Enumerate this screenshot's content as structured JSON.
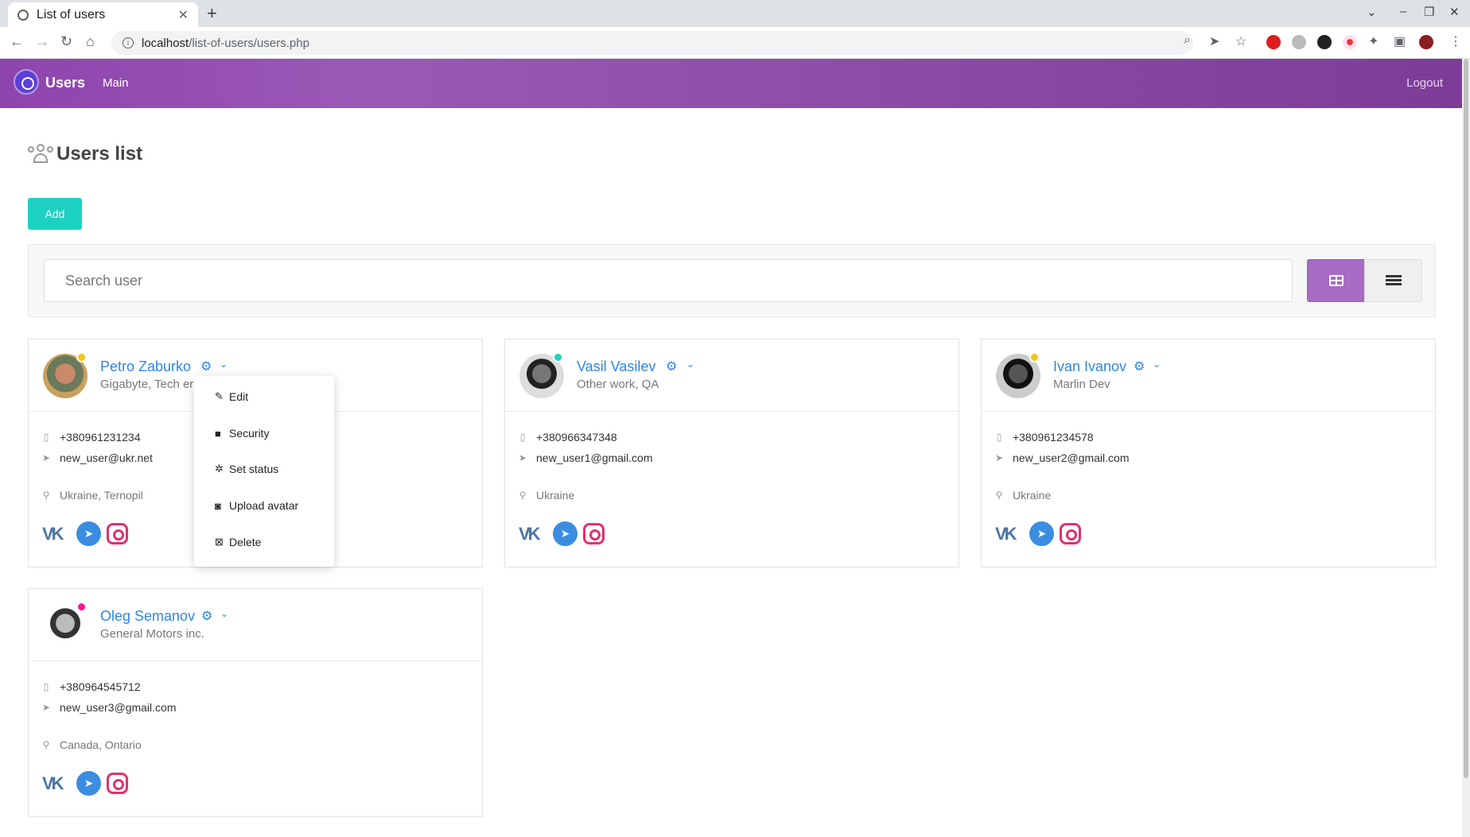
{
  "browser": {
    "tab_title": "List of users",
    "url_host": "localhost",
    "url_path": "/list-of-users/users.php"
  },
  "header": {
    "brand": "Users",
    "nav_main": "Main",
    "logout": "Logout"
  },
  "page": {
    "title": "Users list",
    "add_label": "Add",
    "search_placeholder": "Search user"
  },
  "colors": {
    "header_gradient": [
      "#8e44ad",
      "#7d3c98"
    ],
    "link": "#2f86e6",
    "add_button": "#1dd1c1",
    "grid_toggle_active": "#a76cc4",
    "status_away": "#f5c518",
    "status_online": "#1dd1c1",
    "status_busy": "#ff1493"
  },
  "users": [
    {
      "name": "Petro Zaburko",
      "subtitle": "Gigabyte, Tech er",
      "phone": "+380961231234",
      "email": "new_user@ukr.net",
      "location": "Ukraine, Ternopil",
      "status": "away"
    },
    {
      "name": "Vasil Vasilev",
      "subtitle": "Other work, QA",
      "phone": "+380966347348",
      "email": "new_user1@gmail.com",
      "location": "Ukraine",
      "status": "online"
    },
    {
      "name": "Ivan Ivanov",
      "subtitle": "Marlin Dev",
      "phone": "+380961234578",
      "email": "new_user2@gmail.com",
      "location": "Ukraine",
      "status": "away"
    },
    {
      "name": "Oleg Semanov",
      "subtitle": "General Motors inc.",
      "phone": "+380964545712",
      "email": "new_user3@gmail.com",
      "location": "Canada, Ontario",
      "status": "busy"
    }
  ],
  "dropdown": {
    "items": [
      {
        "label": "Edit",
        "icon": "edit-icon"
      },
      {
        "label": "Security",
        "icon": "lock-icon"
      },
      {
        "label": "Set status",
        "icon": "sun-icon"
      },
      {
        "label": "Upload avatar",
        "icon": "camera-icon"
      },
      {
        "label": "Delete",
        "icon": "close-box-icon"
      }
    ]
  }
}
